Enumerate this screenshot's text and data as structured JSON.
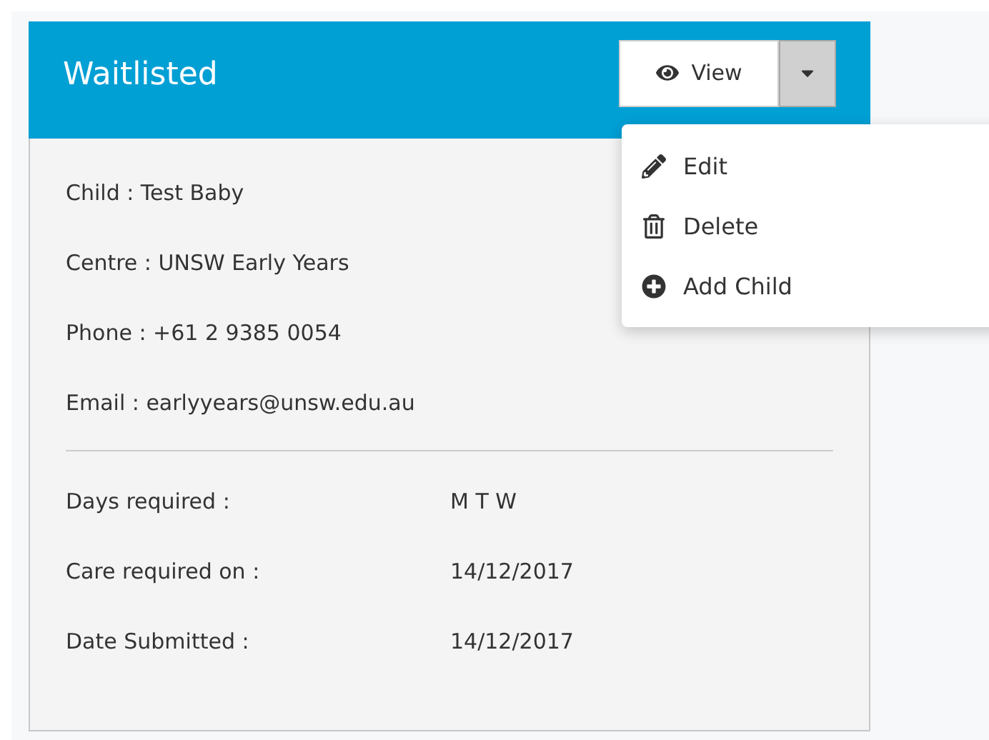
{
  "panel": {
    "title": "Waitlisted",
    "view_button": {
      "label": "View"
    },
    "dropdown": {
      "expanded": true,
      "items": [
        {
          "kind": "edit",
          "label": "Edit"
        },
        {
          "kind": "delete",
          "label": "Delete"
        },
        {
          "kind": "add",
          "label": "Add Child"
        }
      ]
    },
    "contact": [
      {
        "text": "Child : Test Baby"
      },
      {
        "text": "Centre : UNSW Early Years"
      },
      {
        "text": "Phone : +61 2 9385 0054"
      },
      {
        "text": "Email : earlyyears@unsw.edu.au"
      }
    ],
    "details": [
      {
        "label": "Days required :",
        "value": "M T W"
      },
      {
        "label": "Care required on :",
        "value": "14/12/2017"
      },
      {
        "label": "Date Submitted :",
        "value": "14/12/2017"
      }
    ]
  }
}
